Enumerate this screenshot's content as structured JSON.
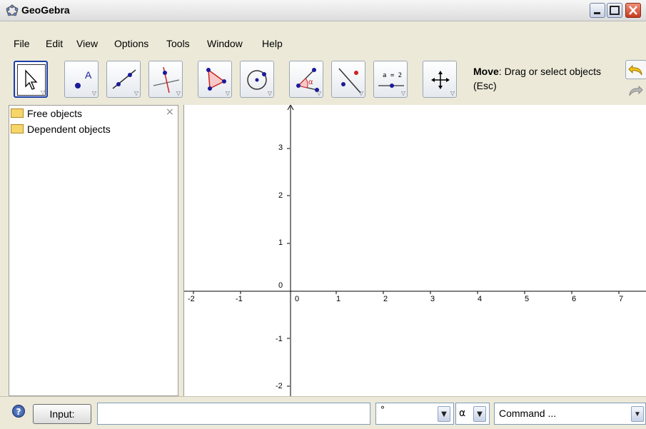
{
  "window": {
    "title": "GeoGebra"
  },
  "menu": [
    "File",
    "Edit",
    "View",
    "Options",
    "Tools",
    "Window",
    "Help"
  ],
  "toolbar": {
    "tools": [
      {
        "name": "move",
        "icon": "cursor-arrow-icon"
      },
      {
        "name": "new-point",
        "icon": "point-a-icon"
      },
      {
        "name": "line-through-two-points",
        "icon": "line-two-points-icon"
      },
      {
        "name": "perpendicular-line",
        "icon": "perpendicular-line-icon"
      },
      {
        "name": "polygon",
        "icon": "polygon-icon"
      },
      {
        "name": "circle-center-point",
        "icon": "circle-icon"
      },
      {
        "name": "angle",
        "icon": "angle-icon"
      },
      {
        "name": "reflect-about-line",
        "icon": "reflect-icon"
      },
      {
        "name": "slider",
        "icon": "slider-icon"
      },
      {
        "name": "move-graphics-view",
        "icon": "move-view-icon"
      }
    ],
    "slider_label": "a = 2",
    "angle_symbol": "α",
    "help_bold": "Move",
    "help_text": ": Drag or select objects (Esc)"
  },
  "algebra": {
    "folders": [
      "Free objects",
      "Dependent objects"
    ],
    "close_symbol": "×"
  },
  "graphics": {
    "x_ticks": [
      "-2",
      "-1",
      "0",
      "1",
      "2",
      "3",
      "4",
      "5",
      "6",
      "7"
    ],
    "y_ticks": [
      "3",
      "2",
      "1",
      "0",
      "-1",
      "-2"
    ],
    "x_range": [
      -2.2,
      7.5
    ],
    "y_range": [
      -2.2,
      3.9
    ]
  },
  "inputbar": {
    "help_symbol": "?",
    "input_label": "Input:",
    "input_value": "",
    "degree_value": "°",
    "alpha_value": "α",
    "command_placeholder": "Command ..."
  },
  "colors": {
    "accent": "#1b3faa",
    "point": "#1a1a99",
    "red": "#cc2222"
  }
}
